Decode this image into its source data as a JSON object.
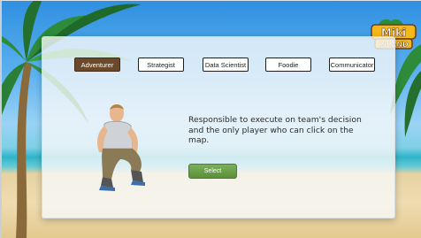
{
  "logo": {
    "line1": "Miki",
    "line2": "ISLAND"
  },
  "tabs": [
    {
      "label": "Adventurer",
      "active": true
    },
    {
      "label": "Strategist",
      "active": false
    },
    {
      "label": "Data Scientist",
      "active": false
    },
    {
      "label": "Foodie",
      "active": false
    },
    {
      "label": "Communicator",
      "active": false
    }
  ],
  "role_description": "Responsible to execute on team's decision and the only player who can click on the map.",
  "select_label": "Select",
  "colors": {
    "active_tab": "#6b4a2c",
    "select_button": "#6aa04a",
    "logo_fill": "#f4b81a"
  }
}
